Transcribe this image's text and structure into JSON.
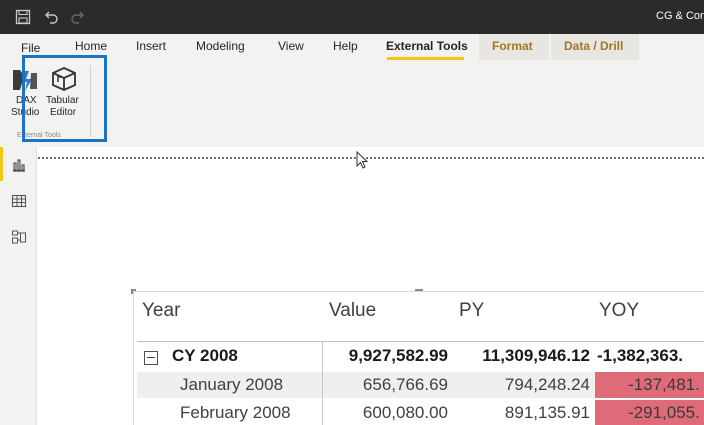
{
  "titlebar": {
    "app_title": "CG & Cons"
  },
  "ribbon": {
    "tabs": {
      "file": "File",
      "home": "Home",
      "insert": "Insert",
      "modeling": "Modeling",
      "view": "View",
      "help": "Help",
      "external_tools": "External Tools",
      "format": "Format",
      "data_drill": "Data / Drill"
    },
    "active_tab": "External Tools",
    "buttons": {
      "dax_label_1": "DAX",
      "dax_label_2": "Studio",
      "tabular_label_1": "Tabular",
      "tabular_label_2": "Editor"
    },
    "group_label": "External Tools",
    "colors": {
      "active_underline": "#f2c811",
      "highlight_box": "#1a73c7",
      "context_tab_text": "#a0781e"
    }
  },
  "leftnav": {
    "items": [
      "report-view",
      "data-view",
      "model-view"
    ]
  },
  "table": {
    "headers": {
      "year": "Year",
      "value": "Value",
      "py": "PY",
      "yoy": "YOY"
    },
    "rows": {
      "total": {
        "year": "CY 2008",
        "value": "9,927,582.99",
        "py": "11,309,946.12",
        "yoy": "-1,382,363."
      },
      "jan": {
        "year": "January 2008",
        "value": "656,766.69",
        "py": "794,248.24",
        "yoy": "-137,481."
      },
      "feb": {
        "year": "February 2008",
        "value": "600,080.00",
        "py": "891,135.91",
        "yoy": "-291,055."
      }
    },
    "colors": {
      "negative_highlight": "#e06b78"
    }
  }
}
